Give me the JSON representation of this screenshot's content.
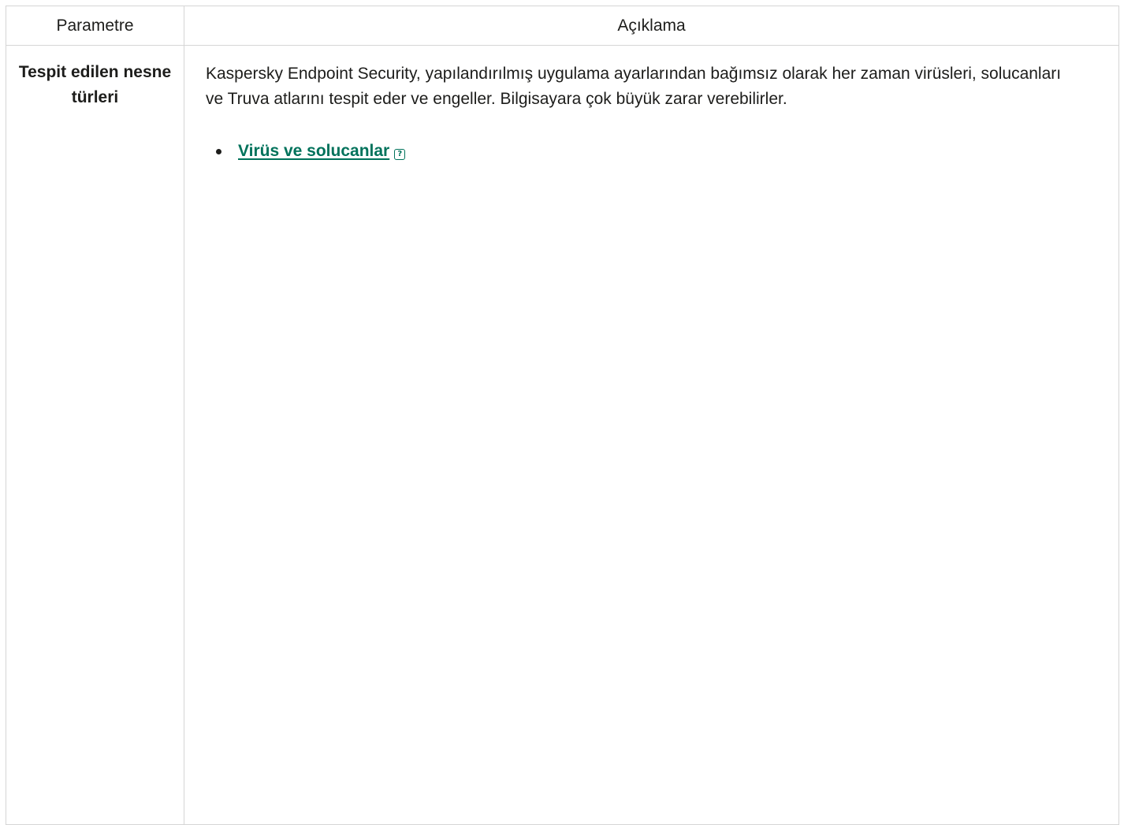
{
  "table": {
    "headers": {
      "param": "Parametre",
      "description": "Açıklama"
    },
    "row": {
      "param_name": "Tespit edilen nesne türleri",
      "description": "Kaspersky Endpoint Security, yapılandırılmış uygulama ayarlarından bağımsız olarak her zaman virüsleri, solucanları ve Truva atlarını tespit eder ve engeller. Bilgisayara çok büyük zarar verebilirler.",
      "list_items": [
        {
          "label": "Virüs ve solucanlar",
          "icon": "help-popup-icon"
        }
      ]
    }
  },
  "colors": {
    "link": "#00725b",
    "border": "#d5d5d5",
    "text": "#1d1d1b"
  }
}
